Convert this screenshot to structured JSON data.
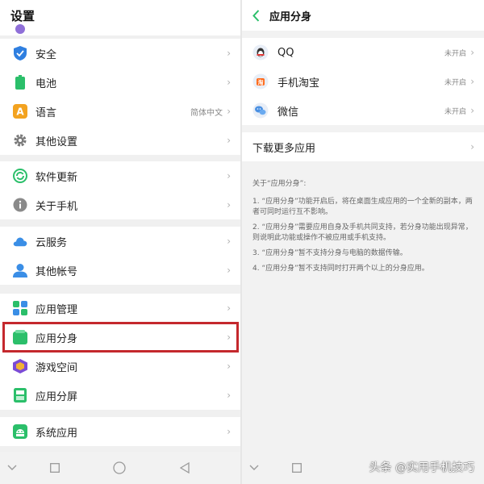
{
  "left": {
    "title": "设置",
    "items": [
      {
        "label": "安全",
        "value": ""
      },
      {
        "label": "电池",
        "value": ""
      },
      {
        "label": "语言",
        "value": "简体中文"
      },
      {
        "label": "其他设置",
        "value": ""
      },
      {
        "label": "软件更新",
        "value": ""
      },
      {
        "label": "关于手机",
        "value": ""
      },
      {
        "label": "云服务",
        "value": ""
      },
      {
        "label": "其他帐号",
        "value": ""
      },
      {
        "label": "应用管理",
        "value": ""
      },
      {
        "label": "应用分身",
        "value": ""
      },
      {
        "label": "游戏空间",
        "value": ""
      },
      {
        "label": "应用分屏",
        "value": ""
      },
      {
        "label": "系统应用",
        "value": ""
      }
    ],
    "language_icon_letter": "A"
  },
  "right": {
    "title": "应用分身",
    "apps": [
      {
        "label": "QQ",
        "status": "未开启"
      },
      {
        "label": "手机淘宝",
        "status": "未开启"
      },
      {
        "label": "微信",
        "status": "未开启"
      }
    ],
    "download_more": "下载更多应用",
    "note_title": "关于“应用分身”:",
    "notes": [
      "1. “应用分身”功能开启后，将在桌面生成应用的一个全新的副本，两者可同时运行互不影响。",
      "2. “应用分身”需要应用自身及手机共同支持，若分身功能出现异常，则说明此功能或操作不被应用或手机支持。",
      "3. “应用分身”暂不支持分身与电脑的数据传输。",
      "4. “应用分身”暂不支持同时打开两个以上的分身应用。"
    ]
  },
  "watermark": "头条 @实用手机技巧",
  "colors": {
    "accent_green": "#2bbf6a",
    "highlight_red": "#c4282d",
    "shield_blue": "#2f7fe0"
  }
}
